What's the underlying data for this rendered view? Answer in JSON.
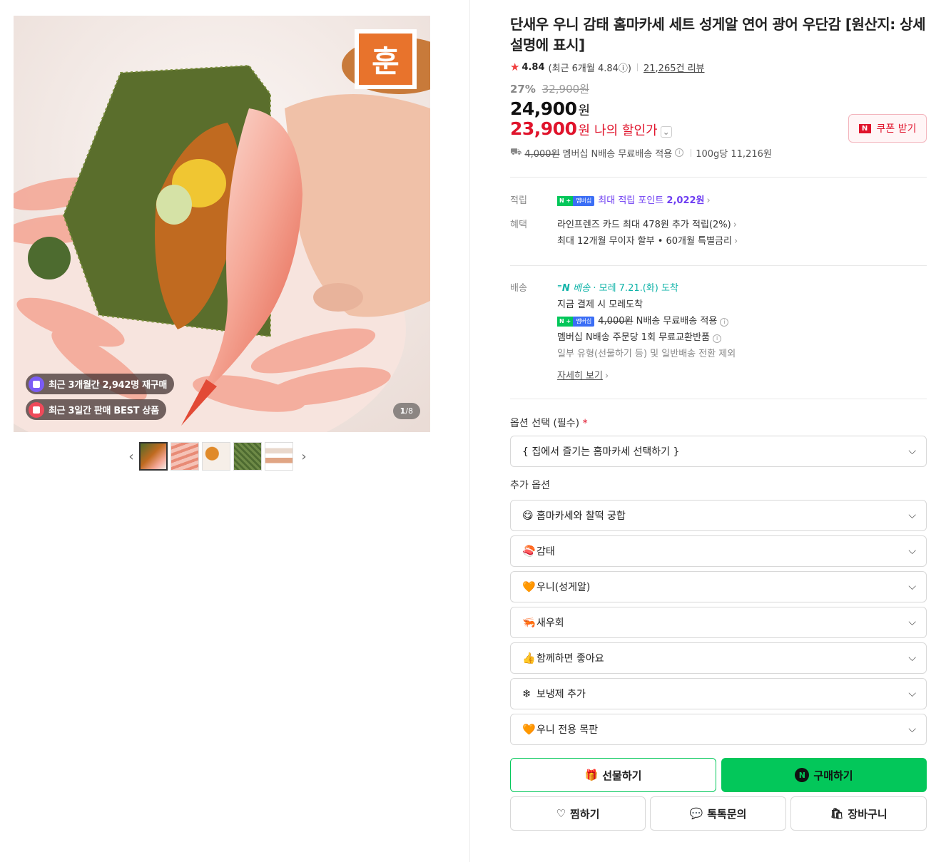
{
  "gallery": {
    "badge_repurchase": "최근 3개월간 2,942명 재구매",
    "badge_best": "최근 3일간 판매 BEST 상품",
    "counter_current": "1",
    "counter_total": "/8",
    "logo_text": "훈"
  },
  "product": {
    "title": "단새우 우니 감태 홈마카세 세트 성게알 연어 광어 우단감 [원산지: 상세설명에 표시]",
    "rating": "4.84",
    "rating_recent": "(최근 6개월 4.84ⓘ)",
    "review_count": "21,265건 리뷰",
    "discount_pct": "27%",
    "original_price": "32,900원",
    "price": "24,900",
    "price_unit": "원",
    "my_price": "23,900",
    "my_price_unit": "원",
    "my_price_label": "나의 할인가",
    "coupon_button": "쿠폰 받기",
    "coupon_badge": "N",
    "shipping_strike": "4,000원",
    "shipping_text": "멤버십 N배송 무료배송 적용",
    "unit_price": "100g당 11,216원"
  },
  "benefits": {
    "points_label": "적립",
    "points_text": "최대 적립 포인트",
    "points_value": "2,022원",
    "membership_badge_n": "N +",
    "membership_badge": "멤버십",
    "benefit_label": "혜택",
    "benefit_card": "라인프렌즈 카드 최대 478원 추가 적립(2%)",
    "benefit_installment": "최대 12개월 무이자 할부 • 60개월 특별금리"
  },
  "delivery": {
    "label": "배송",
    "n_delivery": "배송",
    "arrival": "· 모레 7.21.(화) 도착",
    "pay_now": "지금 결제 시 모레도착",
    "free_strike": "4,000원",
    "free_text": "N배송 무료배송 적용",
    "exchange": "멤버십 N배송 주문당 1회 무료교환반품",
    "exclusion": "일부 유형(선물하기 등) 및 일반배송 전환 제외",
    "more": "자세히 보기"
  },
  "options": {
    "required_label": "옵션 선택 (필수)",
    "required_star": "*",
    "main_select": "{ 집에서 즐기는 홈마카세 선택하기 }",
    "extra_label": "추가 옵션",
    "extra": [
      {
        "emoji": "😋",
        "label": "홈마카세와 찰떡 궁합"
      },
      {
        "emoji": "🍣",
        "label": "감태"
      },
      {
        "emoji": "🧡",
        "label": "우니(성게알)"
      },
      {
        "emoji": "🦐",
        "label": "새우회"
      },
      {
        "emoji": "👍",
        "label": "함께하면 좋아요"
      },
      {
        "emoji": "❄",
        "label": "보냉제 추가"
      },
      {
        "emoji": "🧡",
        "label": "우니 전용 목판"
      }
    ]
  },
  "actions": {
    "gift": "선물하기",
    "buy": "구매하기",
    "buy_badge": "N",
    "wish": "찜하기",
    "talk": "톡톡문의",
    "cart": "장바구니"
  },
  "colors": {
    "naver_green": "#03c75a",
    "price_red": "#e0142c",
    "points_purple": "#6d3cf2",
    "delivery_teal": "#0fb3a8"
  }
}
